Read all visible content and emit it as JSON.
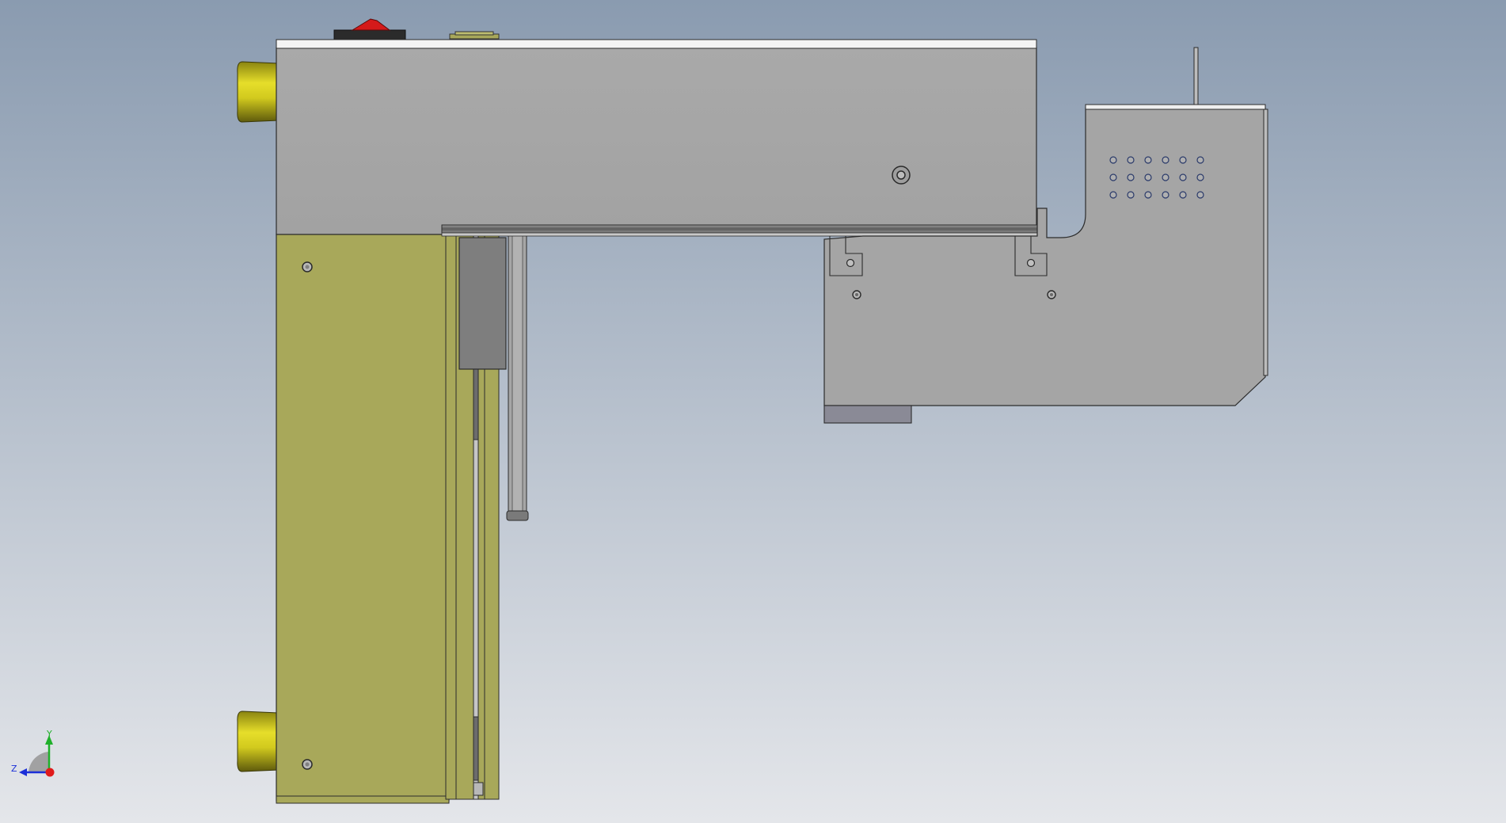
{
  "viewport": {
    "background_top": "#8a9bb0",
    "background_bottom": "#e4e6ea"
  },
  "model": {
    "name": "cad-assembly-side-view",
    "colors": {
      "sheet_metal": "#a6a6a6",
      "sheet_metal_edge": "#2c2c2c",
      "olive_panel": "#a8a85a",
      "olive_panel_dark": "#8f8f48",
      "yellow_knob": "#d8d020",
      "yellow_knob_dark": "#6e6a10",
      "red_switch": "#d41a1a",
      "dark_block": "#7e7e7e",
      "highlight": "#f4f4f4"
    }
  },
  "triad": {
    "y_label": "Y",
    "z_label": "Z",
    "x_color": "#e01b1b",
    "y_color": "#1fb02a",
    "z_color": "#1b2fd8"
  }
}
